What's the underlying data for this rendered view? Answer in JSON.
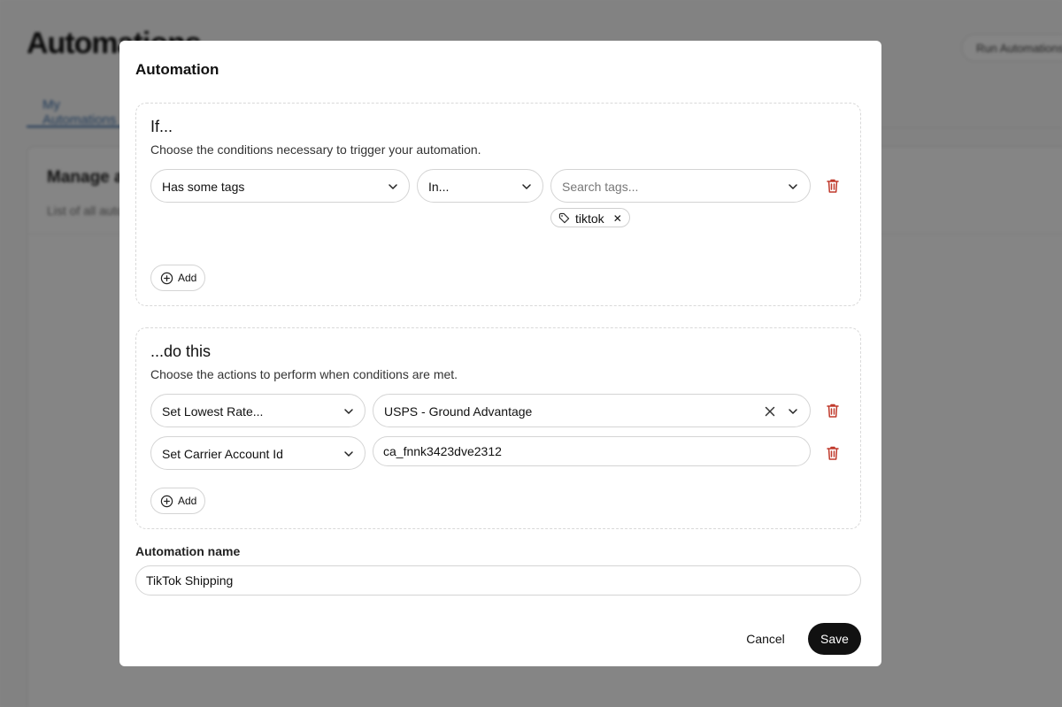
{
  "background": {
    "page_title": "Automations",
    "run_button_label": "Run Automations",
    "tab_label": "My Automations",
    "card_title": "Manage automations",
    "card_subtitle": "List of all automations"
  },
  "modal": {
    "title": "Automation",
    "if_section": {
      "heading": "If...",
      "description": "Choose the conditions necessary to trigger your automation.",
      "condition": {
        "field": "Has some tags",
        "operator": "In...",
        "tags_placeholder": "Search tags...",
        "selected_tags": [
          "tiktok"
        ]
      },
      "add_label": "Add"
    },
    "do_section": {
      "heading": "...do this",
      "description": "Choose the actions to perform when conditions are met.",
      "actions": [
        {
          "type": "Set Lowest Rate...",
          "value": "USPS - Ground Advantage"
        },
        {
          "type": "Set Carrier Account Id",
          "value": "ca_fnnk3423dve2312"
        }
      ],
      "add_label": "Add"
    },
    "name_label": "Automation name",
    "name_value": "TikTok Shipping",
    "cancel_label": "Cancel",
    "save_label": "Save"
  },
  "colors": {
    "accent_dark": "#111111",
    "danger": "#c0392b",
    "overlay": "rgba(0,0,0,0.48)"
  }
}
